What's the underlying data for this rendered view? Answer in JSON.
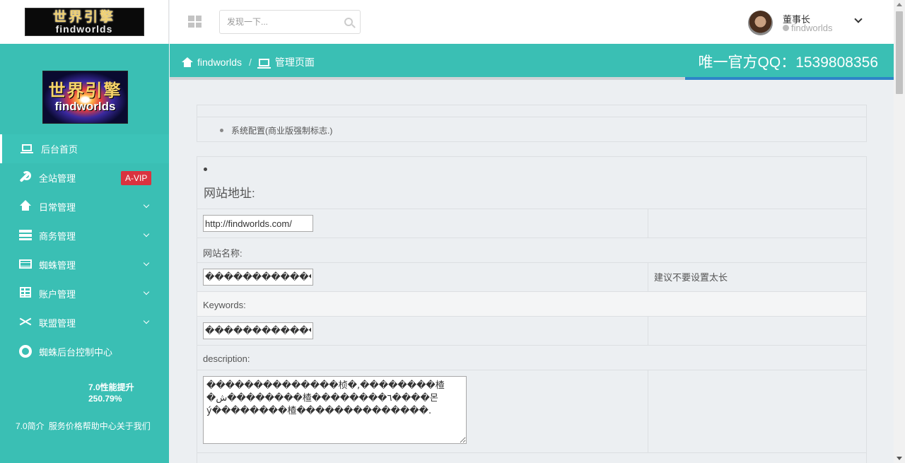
{
  "logo": {
    "cn": "世界引擎",
    "en": "findworlds"
  },
  "search": {
    "placeholder": "发现一下..."
  },
  "user": {
    "name": "董事长",
    "status": "findworlds"
  },
  "sidebar": {
    "items": [
      {
        "label": "后台首页",
        "icon": "laptop-icon",
        "active": true
      },
      {
        "label": "全站管理",
        "icon": "wrench-icon",
        "badge": "A-VIP"
      },
      {
        "label": "日常管理",
        "icon": "home-icon",
        "expandable": true
      },
      {
        "label": "商务管理",
        "icon": "server-icon",
        "expandable": true
      },
      {
        "label": "蜘蛛管理",
        "icon": "list-icon",
        "expandable": true
      },
      {
        "label": "账户管理",
        "icon": "table-icon",
        "expandable": true
      },
      {
        "label": "联盟管理",
        "icon": "shuffle-icon",
        "expandable": true
      },
      {
        "label": "蜘蛛后台控制中心",
        "icon": "lifering-icon"
      }
    ],
    "perf_line1": "7.0性能提升",
    "perf_line2": "250.79%",
    "links": [
      "7.0简介",
      "服务价格",
      "帮助中心",
      "关于我们"
    ]
  },
  "breadcrumb": {
    "home": "findworlds",
    "separator": "/",
    "current": "管理页面",
    "qq": "唯一官方QQ：1539808356"
  },
  "progress": {
    "value": 0.288,
    "color": "#2d86c7"
  },
  "notice": {
    "item": "系统配置(商业版强制标志.)"
  },
  "form": {
    "title": "网站地址:",
    "url_value": "http://findworlds.com/",
    "name_label": "网站名称:",
    "name_value": "�������������",
    "name_hint": "建议不要设置太长",
    "keywords_label": "Keywords:",
    "keywords_value": "�������������",
    "description_label": "description:",
    "description_value": "��������������桢�,��������楂�ش��������楂��������٦����몬ý��������楂��������������."
  },
  "colors": {
    "accent": "#3abfb4",
    "badge": "#d9333f",
    "background": "#eceff2"
  }
}
